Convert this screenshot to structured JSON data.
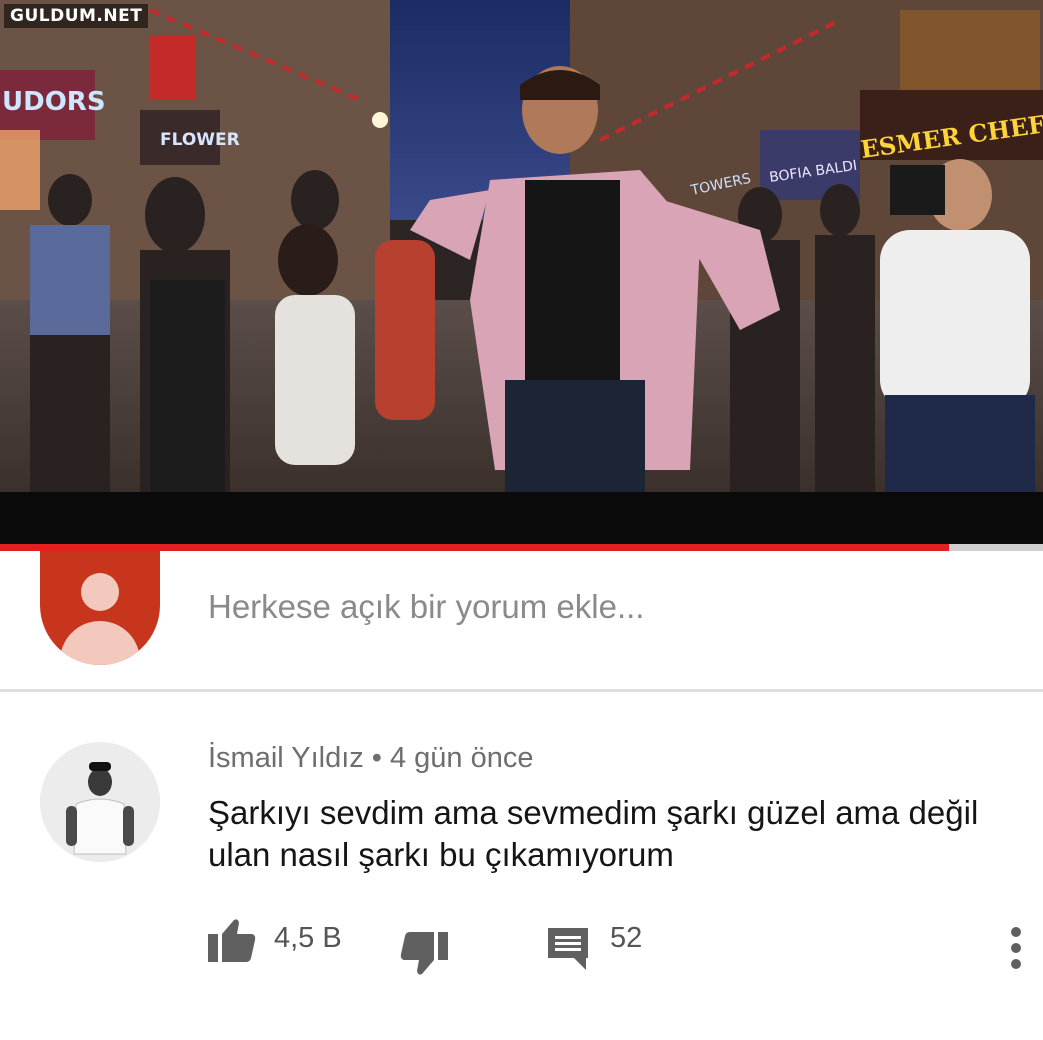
{
  "watermark": "GULDUM.NET",
  "video": {
    "progress_fraction": 0.91,
    "sign_left": "UDORS",
    "sign_flower": "FLOWER",
    "sign_chef": "ESMER CHEF",
    "sign_baldi": "BOFIA BALDI",
    "sign_tower": "TOWERS"
  },
  "add_comment": {
    "placeholder": "Herkese açık bir yorum ekle..."
  },
  "comment": {
    "author": "İsmail Yıldız",
    "separator": "•",
    "time": "4 gün önce",
    "text": "Şarkıyı sevdim ama sevmedim şarkı güzel ama değil ulan nasıl şarkı bu çıkamıyorum",
    "like_count": "4,5 B",
    "reply_count": "52"
  },
  "colors": {
    "progress_red": "#e1201f",
    "avatar_orange": "#c6351c",
    "icon_grey": "#606060"
  },
  "icons": {
    "like": "thumb-up-icon",
    "dislike": "thumb-down-icon",
    "reply": "comment-icon",
    "more": "more-vertical-icon"
  }
}
